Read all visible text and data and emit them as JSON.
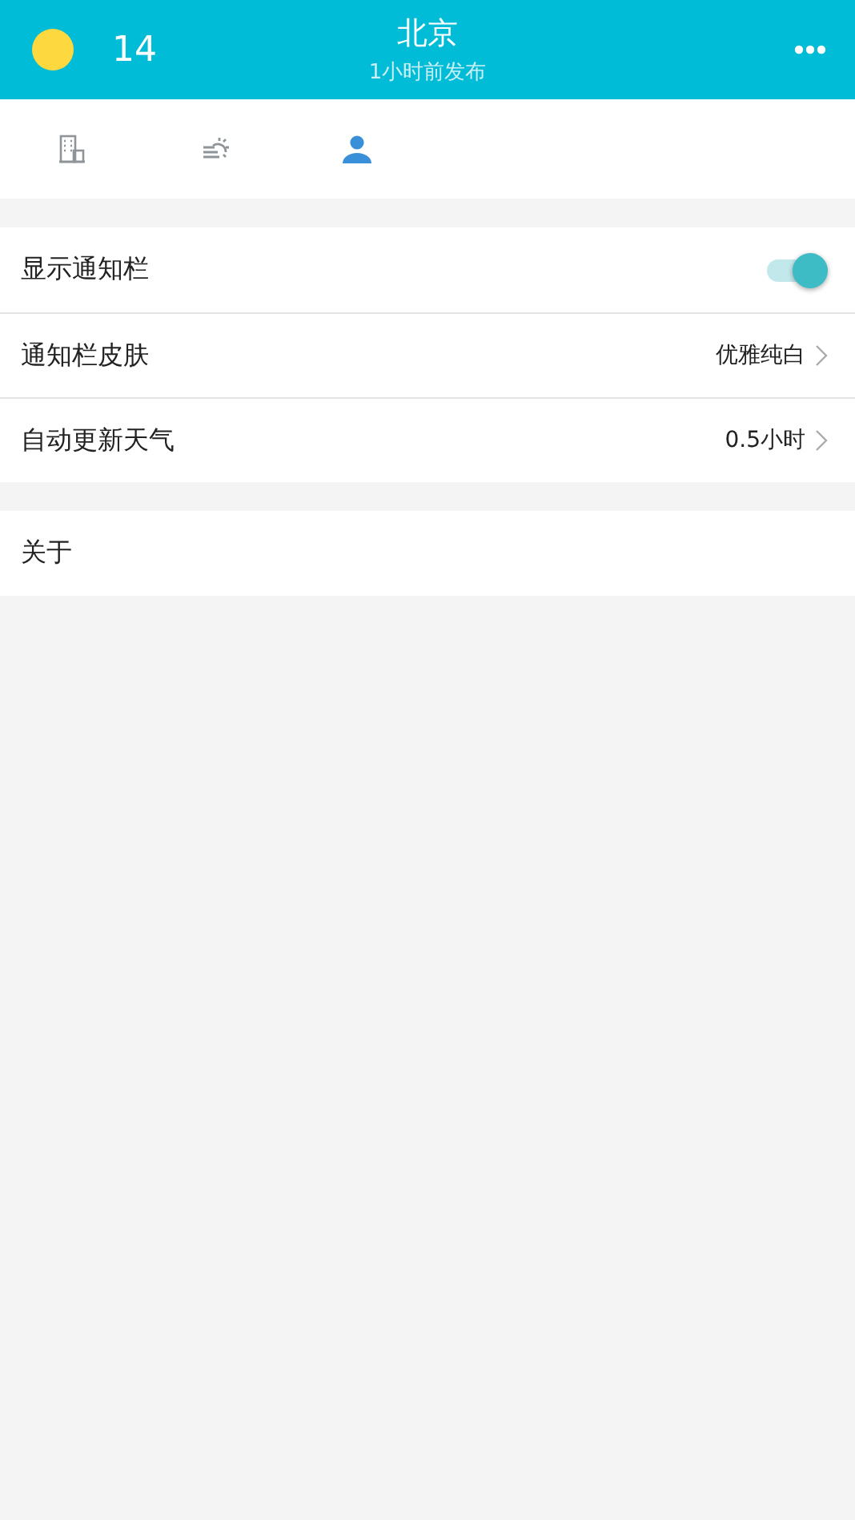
{
  "header": {
    "temperature": "14",
    "city": "北京",
    "updated": "1小时前发布"
  },
  "tabs": [
    {
      "kind": "building",
      "selected": false
    },
    {
      "kind": "weather",
      "selected": false
    },
    {
      "kind": "person",
      "selected": true
    }
  ],
  "groups": [
    {
      "rows": [
        {
          "kind": "toggle",
          "label": "显示通知栏",
          "on": true
        },
        {
          "kind": "value",
          "label": "通知栏皮肤",
          "value": "优雅纯白"
        },
        {
          "kind": "value",
          "label": "自动更新天气",
          "value": "0.5小时"
        }
      ]
    },
    {
      "rows": [
        {
          "kind": "plain",
          "label": "关于"
        }
      ]
    }
  ]
}
